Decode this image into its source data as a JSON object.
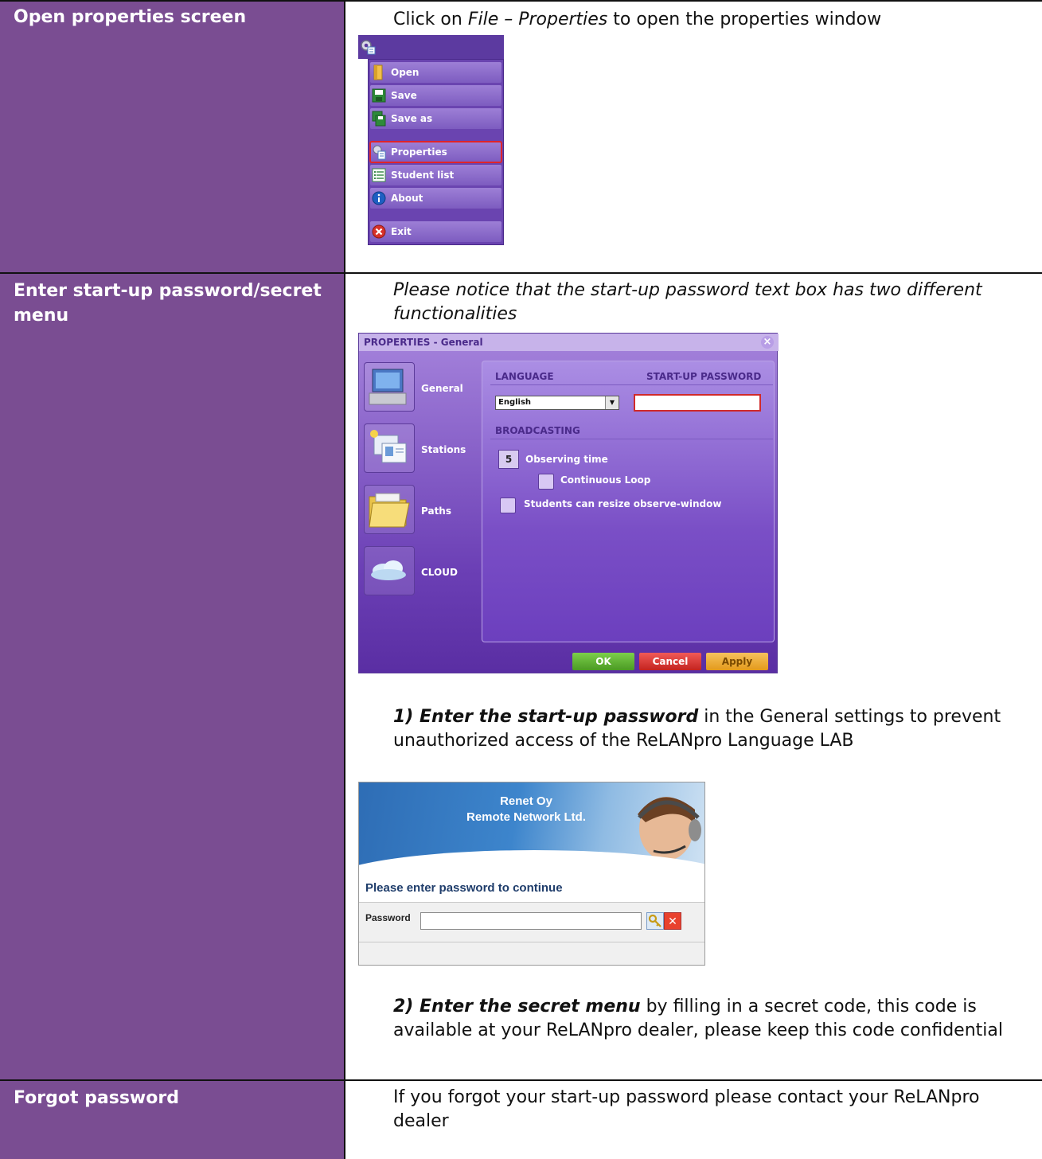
{
  "rows": [
    {
      "label": "Open properties screen",
      "instruction_pre": "Click on ",
      "instruction_em": "File – Properties",
      "instruction_post": " to open the properties window"
    },
    {
      "label": "Enter start-up password/secret menu",
      "note": "Please notice that the start-up password text box has two different functionalities",
      "step1_bold": "1) Enter the start-up password",
      "step1_rest": " in the General settings to prevent unauthorized access of the ReLANpro Language LAB",
      "step2_bold": "2) Enter the secret menu",
      "step2_rest": " by filling in a secret code, this code is available at your ReLANpro dealer, please keep this code confidential"
    },
    {
      "label": "Forgot password",
      "text": "If you forgot your start-up password please contact your ReLANpro dealer"
    }
  ],
  "file_menu": {
    "items": [
      {
        "label": "Open",
        "icon": "folder-icon"
      },
      {
        "label": "Save",
        "icon": "save-icon"
      },
      {
        "label": "Save as",
        "icon": "save-as-icon"
      },
      {
        "label": "Properties",
        "icon": "properties-icon",
        "selected": true
      },
      {
        "label": "Student list",
        "icon": "list-icon"
      },
      {
        "label": "About",
        "icon": "info-icon"
      },
      {
        "label": "Exit",
        "icon": "exit-icon"
      }
    ]
  },
  "properties_dialog": {
    "title": "PROPERTIES - General",
    "tabs": [
      "General",
      "Stations",
      "Paths",
      "CLOUD"
    ],
    "language_header": "LANGUAGE",
    "language_value": "English",
    "password_header": "START-UP PASSWORD",
    "broadcasting_header": "BROADCASTING",
    "observing_value": "5",
    "observing_label": "Observing time",
    "continuous_label": "Continuous Loop",
    "resize_label": "Students can resize observe-window",
    "ok": "OK",
    "cancel": "Cancel",
    "apply": "Apply"
  },
  "password_dialog": {
    "company_line1": "Renet Oy",
    "company_line2": "Remote Network Ltd.",
    "prompt": "Please enter password to continue",
    "password_label": "Password"
  }
}
